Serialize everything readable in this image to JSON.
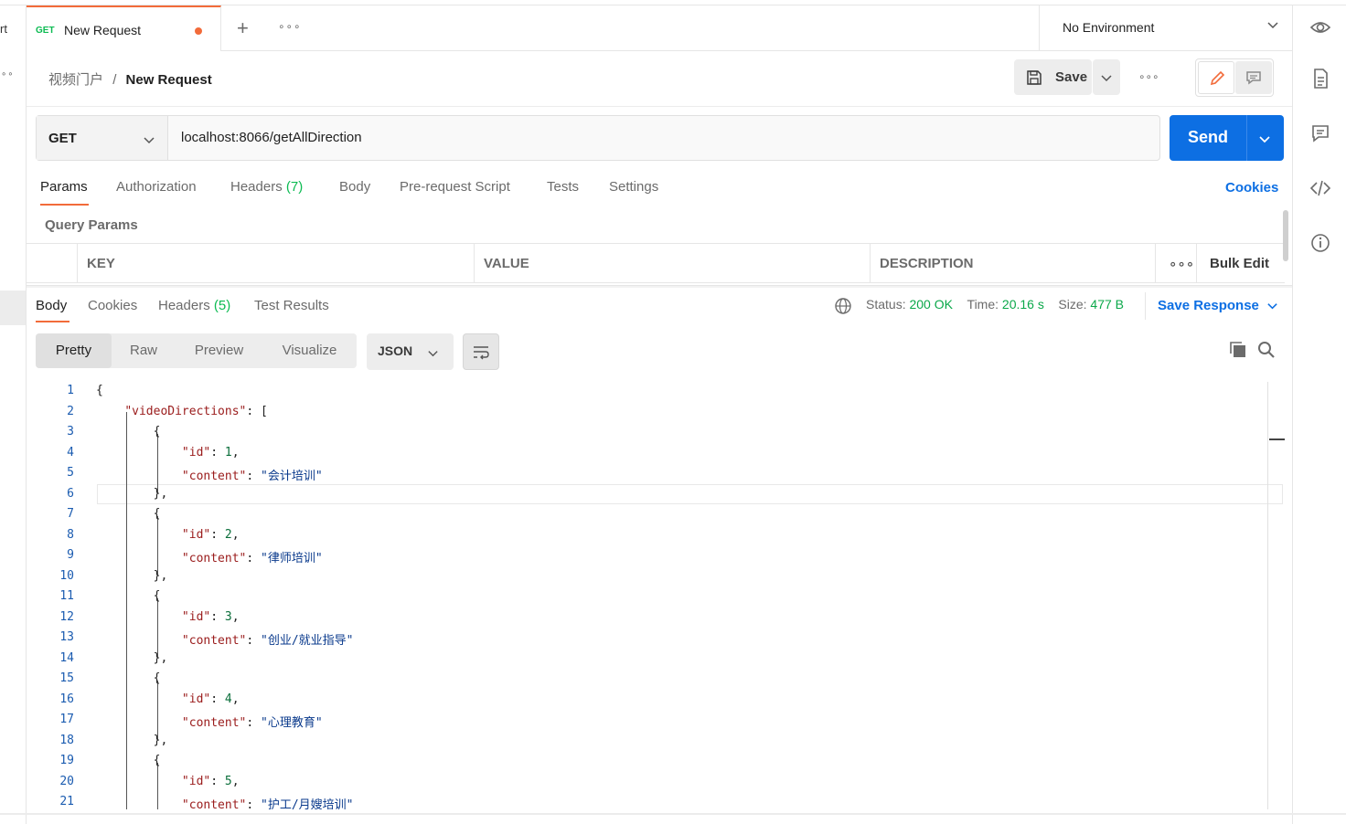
{
  "sidebar_left": {
    "fragment": "rt",
    "more": "∘∘"
  },
  "tab": {
    "method": "GET",
    "title": "New Request"
  },
  "tabbar": {
    "add_icon": "plus-icon",
    "more_icon": "more-icon"
  },
  "environment": {
    "label": "No Environment"
  },
  "breadcrumb": {
    "parent": "视频门户",
    "separator": "/",
    "current": "New Request"
  },
  "toolbar": {
    "save_label": "Save"
  },
  "request": {
    "method": "GET",
    "url": "localhost:8066/getAllDirection",
    "send_label": "Send"
  },
  "request_tabs": [
    {
      "label": "Params",
      "count": ""
    },
    {
      "label": "Authorization",
      "count": ""
    },
    {
      "label": "Headers",
      "count": "(7)"
    },
    {
      "label": "Body",
      "count": ""
    },
    {
      "label": "Pre-request Script",
      "count": ""
    },
    {
      "label": "Tests",
      "count": ""
    },
    {
      "label": "Settings",
      "count": ""
    }
  ],
  "cookies_link": "Cookies",
  "query_params": {
    "title": "Query Params",
    "columns": [
      "KEY",
      "VALUE",
      "DESCRIPTION"
    ],
    "bulk_edit": "Bulk Edit"
  },
  "response_tabs": [
    {
      "label": "Body",
      "count": ""
    },
    {
      "label": "Cookies",
      "count": ""
    },
    {
      "label": "Headers",
      "count": "(5)"
    },
    {
      "label": "Test Results",
      "count": ""
    }
  ],
  "status": {
    "status_label": "Status:",
    "status_value": "200 OK",
    "time_label": "Time:",
    "time_value": "20.16 s",
    "size_label": "Size:",
    "size_value": "477 B",
    "save_response": "Save Response"
  },
  "format_tabs": [
    "Pretty",
    "Raw",
    "Preview",
    "Visualize"
  ],
  "format_select": "JSON",
  "code_lines": [
    "{",
    "    \"videoDirections\": [",
    "        {",
    "            \"id\": 1,",
    "            \"content\": \"会计培训\"",
    "        },",
    "        {",
    "            \"id\": 2,",
    "            \"content\": \"律师培训\"",
    "        },",
    "        {",
    "            \"id\": 3,",
    "            \"content\": \"创业/就业指导\"",
    "        },",
    "        {",
    "            \"id\": 4,",
    "            \"content\": \"心理教育\"",
    "        },",
    "        {",
    "            \"id\": 5,",
    "            \"content\": \"护工/月嫂培训\""
  ],
  "colors": {
    "accent": "#f26b3a",
    "primary": "#0d6fe3",
    "success": "#0cbb52"
  }
}
